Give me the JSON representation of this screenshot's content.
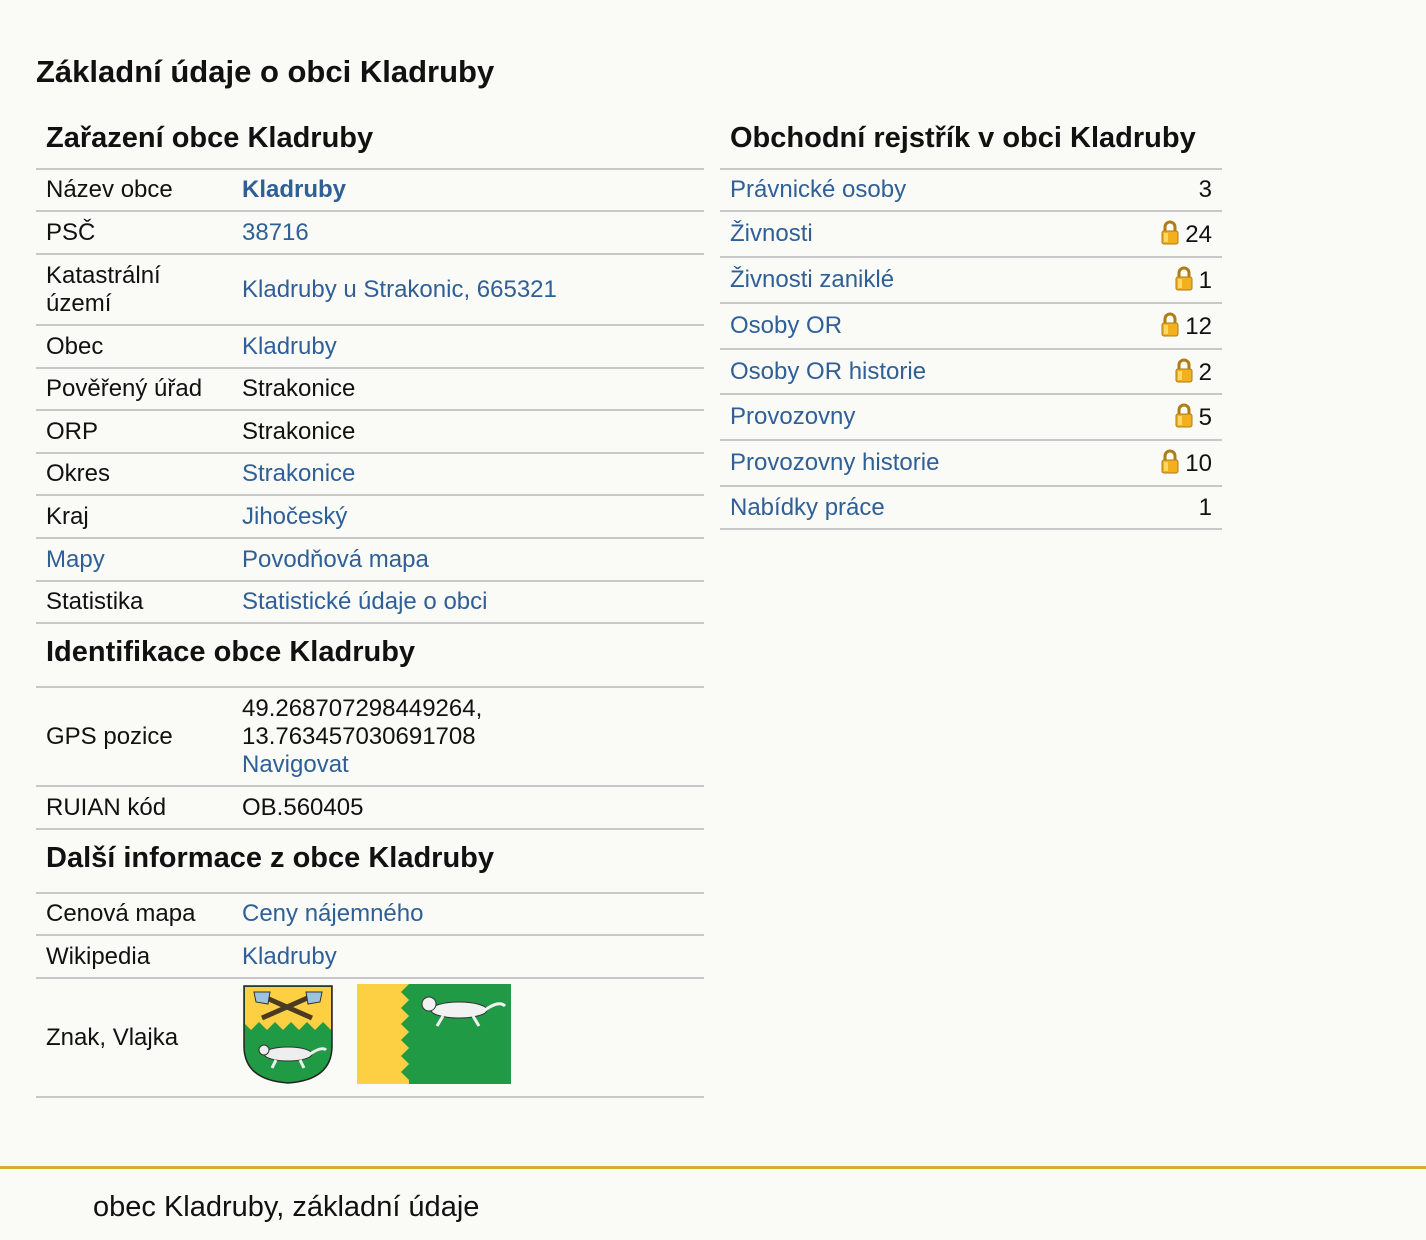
{
  "page_title": "Základní údaje o obci Kladruby",
  "zarazeni": {
    "title": "Zařazení obce Kladruby",
    "rows": [
      {
        "label": "Název obce",
        "value": "Kladruby"
      },
      {
        "label": "PSČ",
        "value": "38716"
      },
      {
        "label": "Katastrální území",
        "value": "Kladruby u Strakonic, 665321"
      },
      {
        "label": "Obec",
        "value": "Kladruby"
      },
      {
        "label": "Pověřený úřad",
        "value": "Strakonice"
      },
      {
        "label": "ORP",
        "value": "Strakonice"
      },
      {
        "label": "Okres",
        "value": "Strakonice"
      },
      {
        "label": "Kraj",
        "value": "Jihočeský"
      },
      {
        "label": "Mapy",
        "value": "Povodňová mapa"
      },
      {
        "label": "Statistika",
        "value": "Statistické údaje o obci"
      }
    ]
  },
  "identifikace": {
    "title": "Identifikace obce Kladruby",
    "gps_label": "GPS pozice",
    "gps_lat": "49.268707298449264,",
    "gps_lon": "13.763457030691708",
    "navigate": "Navigovat",
    "ruian_label": "RUIAN kód",
    "ruian_value": "OB.560405"
  },
  "dalsi": {
    "title": "Další informace z obce Kladruby",
    "cenova_label": "Cenová mapa",
    "cenova_value": "Ceny nájemného",
    "wiki_label": "Wikipedia",
    "wiki_value": "Kladruby",
    "znak_label": "Znak, Vlajka"
  },
  "rejstrik": {
    "title": "Obchodní rejstřík v obci Kladruby",
    "rows": [
      {
        "label": "Právnické osoby",
        "value": "3",
        "locked": false
      },
      {
        "label": "Živnosti",
        "value": "24",
        "locked": true
      },
      {
        "label": "Živnosti zaniklé",
        "value": "1",
        "locked": true
      },
      {
        "label": "Osoby OR",
        "value": "12",
        "locked": true
      },
      {
        "label": "Osoby OR historie",
        "value": "2",
        "locked": true
      },
      {
        "label": "Provozovny",
        "value": "5",
        "locked": true
      },
      {
        "label": "Provozovny historie",
        "value": "10",
        "locked": true
      },
      {
        "label": "Nabídky práce",
        "value": "1",
        "locked": false
      }
    ]
  },
  "footer_text": "obec Kladruby, základní údaje",
  "colors": {
    "link": "#2f5f97",
    "accent_line": "#d6ad2e",
    "flag_yellow": "#fdd043",
    "flag_green": "#209a44"
  }
}
